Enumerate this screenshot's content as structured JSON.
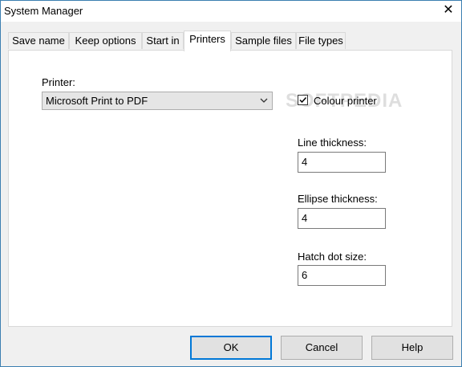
{
  "window": {
    "title": "System Manager",
    "close_glyph": "✕"
  },
  "tabs": [
    {
      "label": "Save name",
      "active": false
    },
    {
      "label": "Keep options",
      "active": false
    },
    {
      "label": "Start in",
      "active": false
    },
    {
      "label": "Printers",
      "active": true
    },
    {
      "label": "Sample files",
      "active": false
    },
    {
      "label": "File types",
      "active": false
    }
  ],
  "printers": {
    "printer_label": "Printer:",
    "printer_value": "Microsoft Print to PDF",
    "colour_printer_label": "Colour printer",
    "colour_printer_checked": true,
    "line_thickness_label": "Line thickness:",
    "line_thickness_value": "4",
    "ellipse_thickness_label": "Ellipse thickness:",
    "ellipse_thickness_value": "4",
    "hatch_dot_size_label": "Hatch dot size:",
    "hatch_dot_size_value": "6"
  },
  "watermark": "SOFTPEDIA",
  "buttons": {
    "ok": "OK",
    "cancel": "Cancel",
    "help": "Help"
  },
  "colors": {
    "focus": "#0078d7",
    "window_border": "#3c7fb1"
  }
}
